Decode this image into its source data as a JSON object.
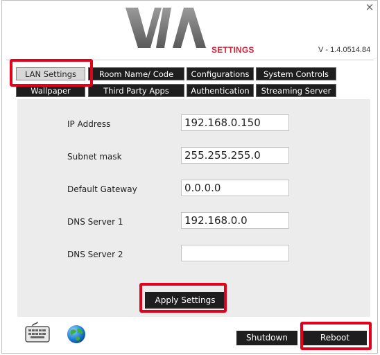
{
  "window": {
    "close_symbol": "×"
  },
  "header": {
    "logo_text": "VIA",
    "settings_title": "SETTINGS",
    "version": "V - 1.4.0514.84"
  },
  "tabs_row1": [
    {
      "label": "LAN Settings",
      "active": true
    },
    {
      "label": "Room Name/ Code"
    },
    {
      "label": "Configurations"
    },
    {
      "label": "System Controls"
    }
  ],
  "tabs_row2": [
    {
      "label": "Wallpaper"
    },
    {
      "label": "Third Party Apps"
    },
    {
      "label": "Authentication"
    },
    {
      "label": "Streaming Server"
    }
  ],
  "form": {
    "fields": [
      {
        "label": "IP Address",
        "value": "192.168.0.150"
      },
      {
        "label": "Subnet mask",
        "value": "255.255.255.0"
      },
      {
        "label": "Default Gateway",
        "value": "0.0.0.0"
      },
      {
        "label": "DNS Server 1",
        "value": "192.168.0.0"
      },
      {
        "label": "DNS Server 2",
        "value": ""
      }
    ],
    "apply_label": "Apply Settings"
  },
  "footer": {
    "shutdown_label": "Shutdown",
    "reboot_label": "Reboot",
    "icons": [
      "keyboard-icon",
      "globe-icon"
    ]
  },
  "colors": {
    "highlight": "#e3001b",
    "brand_red": "#d4243a",
    "button_dark": "#1e1e1e",
    "panel_bg": "#ececec"
  }
}
